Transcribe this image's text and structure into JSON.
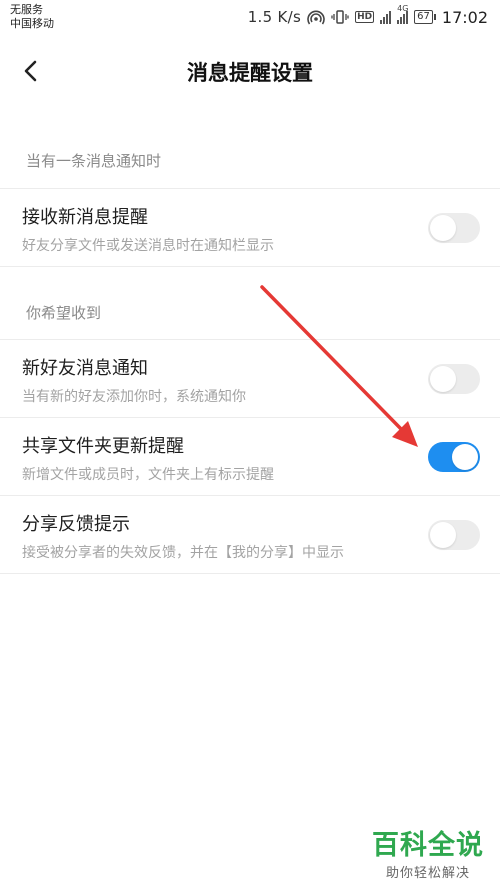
{
  "status_bar": {
    "carrier_line1": "无服务",
    "carrier_line2": "中国移动",
    "net_speed": "1.5 K/s",
    "hd": "HD",
    "net_4g": "4G",
    "battery": "67",
    "time": "17:02",
    "icons": [
      "hotspot-icon",
      "vibrate-icon",
      "hd-icon",
      "signal-icon",
      "4g-signal-icon",
      "battery-icon"
    ]
  },
  "header": {
    "title": "消息提醒设置",
    "back_icon": "chevron-left-icon"
  },
  "sections": [
    {
      "label": "当有一条消息通知时",
      "items": [
        {
          "title": "接收新消息提醒",
          "subtitle": "好友分享文件或发送消息时在通知栏显示",
          "enabled": false
        }
      ]
    },
    {
      "label": "你希望收到",
      "items": [
        {
          "title": "新好友消息通知",
          "subtitle": "当有新的好友添加你时，系统通知你",
          "enabled": false
        },
        {
          "title": "共享文件夹更新提醒",
          "subtitle": "新增文件或成员时，文件夹上有标示提醒",
          "enabled": true
        },
        {
          "title": "分享反馈提示",
          "subtitle": "接受被分享者的失效反馈，并在【我的分享】中显示",
          "enabled": false
        }
      ]
    }
  ],
  "colors": {
    "toggle_on": "#1e8ef0",
    "toggle_off": "#ececec",
    "annotation_arrow": "#e53935",
    "watermark": "#2fa84f"
  },
  "watermark": {
    "brand": "百科全说",
    "tagline": "助你轻松解决"
  }
}
